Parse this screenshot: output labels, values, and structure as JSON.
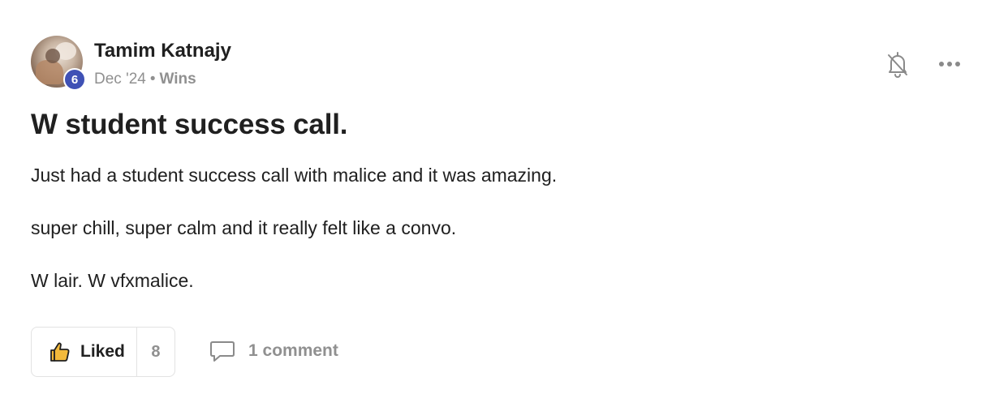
{
  "post": {
    "author": {
      "name": "Tamim Katnajy",
      "level": "6"
    },
    "meta": {
      "date": "Dec '24",
      "separator": "•",
      "category": "Wins"
    },
    "title": "W student success call.",
    "body": [
      "Just had a student success call with malice and it was amazing.",
      "super chill, super calm and it really felt like a convo.",
      "W lair. W vfxmalice."
    ],
    "actions": {
      "like_label": "Liked",
      "like_count": "8",
      "comment_label": "1 comment"
    },
    "icons": {
      "notification": "bell-off-icon",
      "more": "more-horizontal-icon",
      "like": "thumbs-up-icon",
      "comment": "comment-icon"
    },
    "colors": {
      "badge": "#3f51b5",
      "like_icon": "#f2b93b",
      "muted_text": "#909090"
    }
  }
}
